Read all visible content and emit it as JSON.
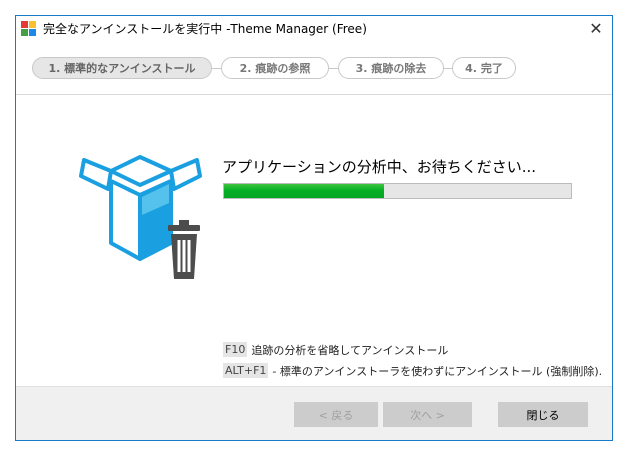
{
  "window": {
    "title": "完全なアンインストールを実行中 -Theme Manager (Free)",
    "close_glyph": "✕",
    "accent_color": "#1979ca"
  },
  "steps": [
    {
      "label": "1. 標準的なアンインストール",
      "active": true
    },
    {
      "label": "2. 痕跡の参照",
      "active": false
    },
    {
      "label": "3. 痕跡の除去",
      "active": false
    },
    {
      "label": "4. 完了",
      "active": false
    }
  ],
  "main": {
    "illustration_icon": "box-with-trash-icon",
    "status_text": "アプリケーションの分析中、お待ちください...",
    "progress_percent": 46,
    "progress_color": "#06b025"
  },
  "hints": [
    {
      "key": "F10",
      "text": "追跡の分析を省略してアンインストール"
    },
    {
      "key": "ALT+F1",
      "text": "- 標準のアンインストーラを使わずにアンインストール (強制削除)."
    }
  ],
  "footer": {
    "back_label": "< 戻る",
    "next_label": "次へ >",
    "close_label": "閉じる"
  }
}
